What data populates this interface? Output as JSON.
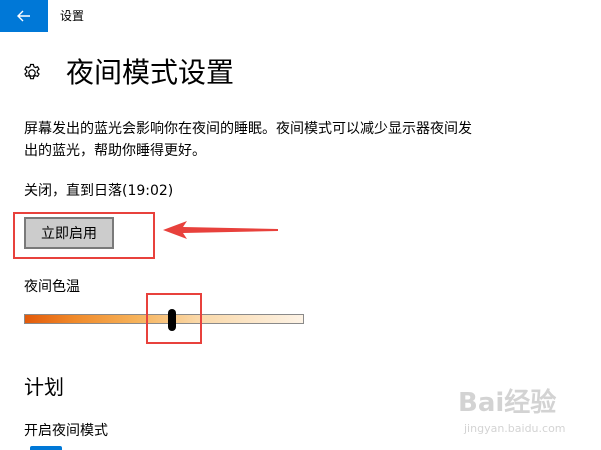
{
  "titlebar": {
    "app_title": "设置",
    "back_icon": "back-arrow-icon"
  },
  "header": {
    "icon": "gear-icon",
    "title": "夜间模式设置"
  },
  "description": "屏幕发出的蓝光会影响你在夜间的睡眠。夜间模式可以减少显示器夜间发出的蓝光，帮助你睡得更好。",
  "status": {
    "text": "关闭，直到日落(19:02)"
  },
  "enable_button": {
    "label": "立即启用"
  },
  "color_temperature": {
    "label": "夜间色温",
    "value_fraction": 0.53
  },
  "schedule": {
    "heading": "计划",
    "toggle_label": "开启夜间模式"
  },
  "watermark": {
    "logo": "Bai经验",
    "url": "jingyan.baidu.com"
  },
  "colors": {
    "accent": "#0078d7",
    "annotation": "#e8413c",
    "button_bg": "#cccccc"
  }
}
